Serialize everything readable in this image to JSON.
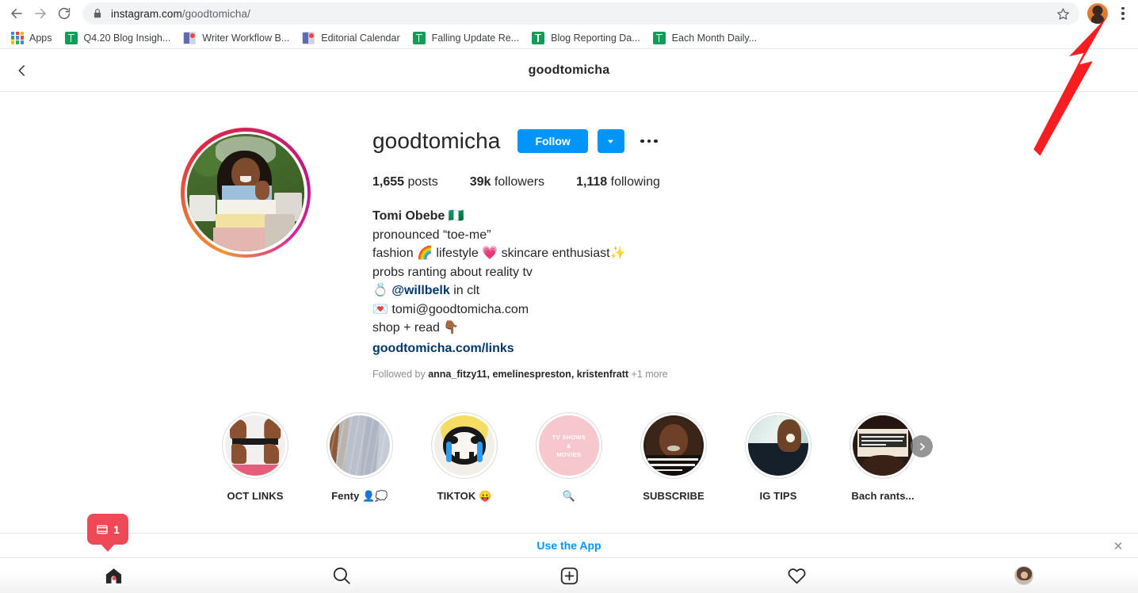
{
  "browser": {
    "back_icon": "back-arrow-icon",
    "forward_icon": "forward-arrow-icon",
    "reload_icon": "reload-icon",
    "lock_icon": "lock-icon",
    "url_host": "instagram.com",
    "url_path": "/goodtomicha/",
    "star_icon": "bookmark-star-icon",
    "profile_icon": "chrome-profile-avatar",
    "menu_icon": "chrome-kebab-menu-icon",
    "bookmarks": [
      {
        "label": "Apps",
        "icon": "apps-grid-icon"
      },
      {
        "label": "Q4.20 Blog Insigh...",
        "icon": "google-sheets-icon"
      },
      {
        "label": "Writer Workflow B...",
        "icon": "google-slides-icon"
      },
      {
        "label": "Editorial Calendar",
        "icon": "google-slides-icon"
      },
      {
        "label": "Falling Update Re...",
        "icon": "google-sheets-icon"
      },
      {
        "label": "Blog Reporting Da...",
        "icon": "google-sheets-icon"
      },
      {
        "label": "Each Month Daily...",
        "icon": "google-sheets-icon"
      }
    ]
  },
  "page_header": {
    "back_icon": "chevron-left-icon",
    "title": "goodtomicha"
  },
  "profile": {
    "avatar_name": "profile-picture",
    "username": "goodtomicha",
    "follow_label": "Follow",
    "dropdown_icon": "chevron-down-icon",
    "more_icon": "more-options-icon",
    "stats": [
      {
        "value": "1,655",
        "label": "posts"
      },
      {
        "value": "39k",
        "label": "followers"
      },
      {
        "value": "1,118",
        "label": "following"
      }
    ],
    "bio": {
      "full_name": "Tomi Obebe",
      "full_name_emoji": "🇳🇬",
      "lines": [
        "pronounced “toe-me”",
        "fashion 🌈 lifestyle 💗 skincare enthusiast✨",
        "probs ranting about reality tv"
      ],
      "partner_emoji": "💍",
      "partner_handle": "@willbelk",
      "partner_suffix": " in clt",
      "email_emoji": "💌",
      "email": "tomi@goodtomicha.com",
      "shop_line": "shop + read 👇🏾",
      "link": "goodtomicha.com/links"
    },
    "followed_by": {
      "prefix": "Followed by ",
      "names": "anna_fitzy11, emelinespreston, kristenfratt",
      "suffix": " +1 more"
    }
  },
  "highlights": {
    "next_icon": "chevron-right-icon",
    "items": [
      {
        "label": "OCT LINKS",
        "art": "a-boots"
      },
      {
        "label": "Fenty 👤💭",
        "art": "a-fenty"
      },
      {
        "label": "TIKTOK 😛",
        "art": "a-tiktok"
      },
      {
        "label": "🔍",
        "art": "a-tv",
        "cover_text": "TV SHOWS\n&\nMOVIES"
      },
      {
        "label": "SUBSCRIBE",
        "art": "a-sub"
      },
      {
        "label": "IG TIPS",
        "art": "a-ig"
      },
      {
        "label": "Bach rants...",
        "art": "a-bach"
      }
    ],
    "tv_cover_lines": [
      "TV SHOWS",
      "&",
      "MOVIES"
    ]
  },
  "app_bar": {
    "link_label": "Use the App",
    "close_label": "✕"
  },
  "bottom_nav": {
    "items": [
      {
        "name": "home",
        "icon": "home-icon",
        "active": true
      },
      {
        "name": "search",
        "icon": "search-icon",
        "active": false
      },
      {
        "name": "new-post",
        "icon": "plus-square-icon",
        "active": false
      },
      {
        "name": "activity",
        "icon": "heart-icon",
        "active": false
      },
      {
        "name": "profile",
        "icon": "user-avatar-icon",
        "active": false
      }
    ]
  },
  "notification_badge": {
    "icon": "story-card-icon",
    "count": "1"
  },
  "annotation": {
    "arrow_name": "red-pointer-arrow",
    "color": "#f71e22"
  }
}
